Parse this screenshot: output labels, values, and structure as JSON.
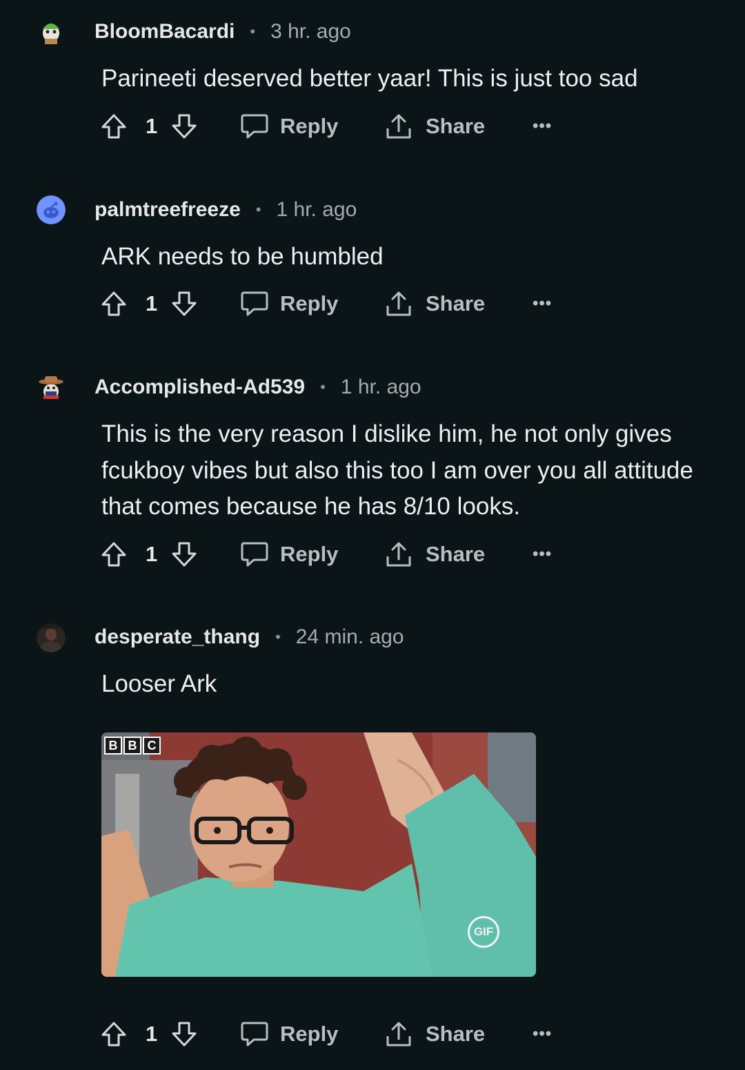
{
  "comments": [
    {
      "username": "BloomBacardi",
      "time": "3 hr. ago",
      "text": "Parineeti deserved better yaar! This is just too sad",
      "score": "1",
      "reply_label": "Reply",
      "share_label": "Share",
      "avatar_icon": "snoo-green-helmet-avatar"
    },
    {
      "username": "palmtreefreeze",
      "time": "1 hr. ago",
      "text": "ARK needs to be humbled",
      "score": "1",
      "reply_label": "Reply",
      "share_label": "Share",
      "avatar_icon": "default-snoo-avatar"
    },
    {
      "username": "Accomplished-Ad539",
      "time": "1 hr. ago",
      "text": "This is the very reason I dislike him, he not only gives fcukboy vibes but also this too I am over you all attitude that comes because he has 8/10 looks.",
      "score": "1",
      "reply_label": "Reply",
      "share_label": "Share",
      "avatar_icon": "snoo-cowboy-avatar"
    },
    {
      "username": "desperate_thang",
      "time": "24 min. ago",
      "text": "Looser Ark",
      "score": "1",
      "reply_label": "Reply",
      "share_label": "Share",
      "avatar_icon": "photo-avatar",
      "gif": {
        "watermark": [
          "B",
          "B",
          "C"
        ],
        "badge": "GIF"
      }
    }
  ],
  "separator": "•",
  "more_label": "•••",
  "colors": {
    "background": "#0b1416",
    "text": "#edeff1",
    "muted": "#a4acb0"
  }
}
